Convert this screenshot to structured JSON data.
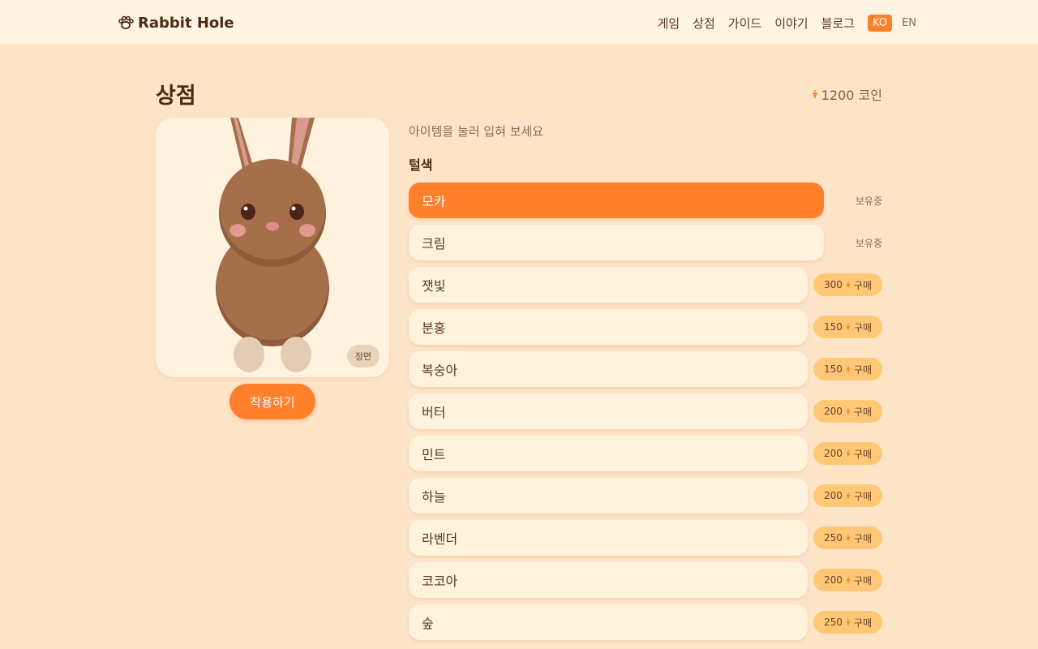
{
  "header": {
    "brand": "Rabbit Hole",
    "nav": [
      "게임",
      "상점",
      "가이드",
      "이야기",
      "블로그"
    ],
    "lang_active": "KO",
    "lang_other": "EN"
  },
  "page": {
    "title": "상점",
    "coins": "1200 코인"
  },
  "preview": {
    "view_label": "정면",
    "apply_label": "착용하기"
  },
  "shop": {
    "hint": "아이템을 눌러 입혀 보세요",
    "section": "털색",
    "owned_label": "보유중",
    "buy_label": "구매",
    "items": [
      {
        "name": "모카",
        "owned": true,
        "selected": true
      },
      {
        "name": "크림",
        "owned": true
      },
      {
        "name": "잿빛",
        "price": 300
      },
      {
        "name": "분홍",
        "price": 150
      },
      {
        "name": "복숭아",
        "price": 150
      },
      {
        "name": "버터",
        "price": 200
      },
      {
        "name": "민트",
        "price": 200
      },
      {
        "name": "하늘",
        "price": 200
      },
      {
        "name": "라벤더",
        "price": 250
      },
      {
        "name": "코코아",
        "price": 200
      },
      {
        "name": "숲",
        "price": 250
      }
    ]
  },
  "colors": {
    "accent": "#ff7f2a",
    "fur": "#a56f4a",
    "background": "#ffe5c8"
  }
}
